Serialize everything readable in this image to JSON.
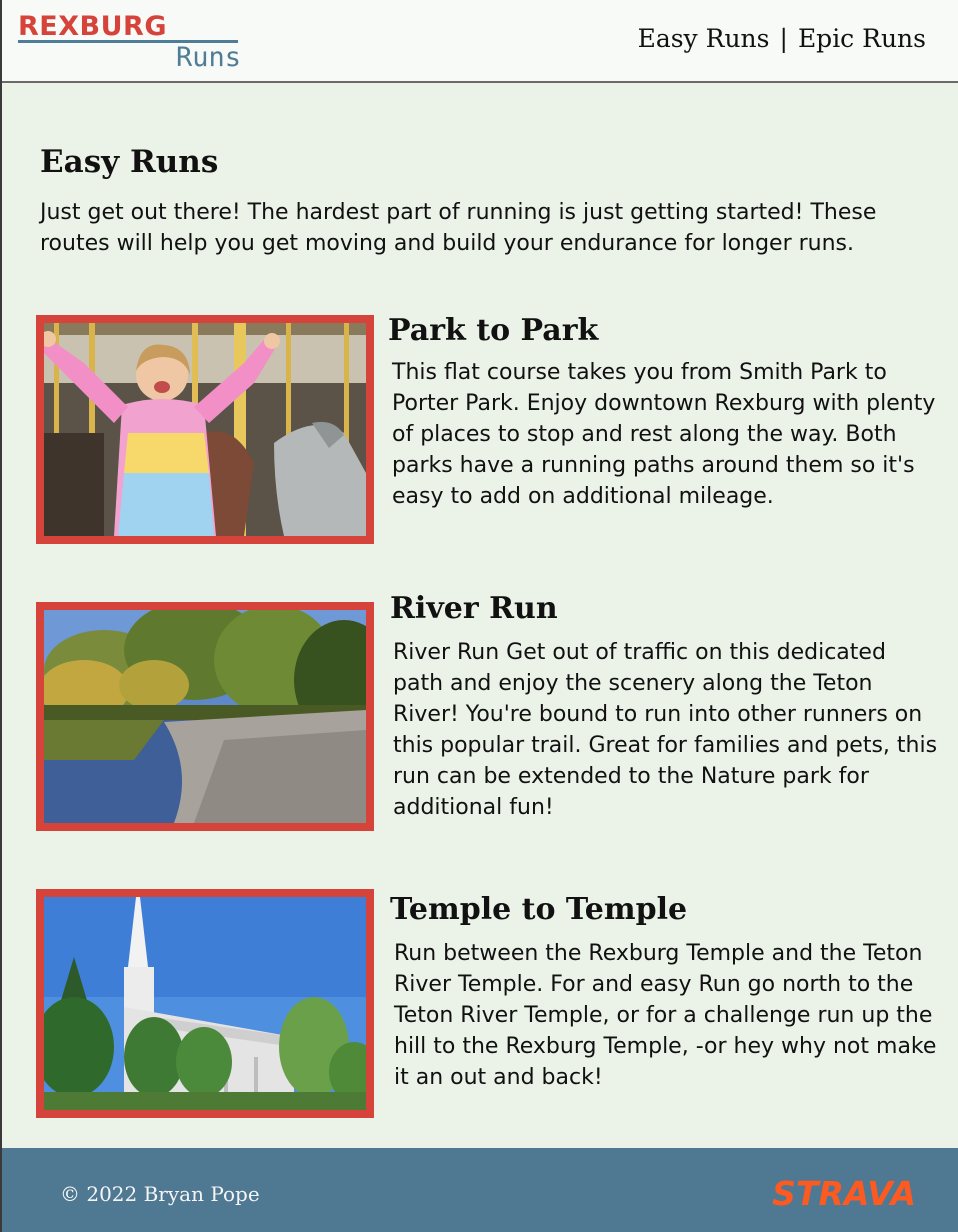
{
  "brand": {
    "top": "REXBURG",
    "bottom": "Runs"
  },
  "nav": {
    "easy": "Easy Runs",
    "separator": "|",
    "epic": "Epic Runs"
  },
  "page": {
    "title": "Easy Runs",
    "intro": "Just get out there! The hardest part of running is just getting started! These routes will help you get moving and build your endurance for longer runs."
  },
  "routes": [
    {
      "title": "Park to Park",
      "description": "This flat course takes you from Smith Park to Porter Park. Enjoy downtown Rexburg with plenty of places to stop and rest along the way. Both parks have a running paths around them so it's easy to add on additional mileage.",
      "photo": "carousel-girl-photo"
    },
    {
      "title": "River Run",
      "description": "River Run Get out of traffic on this dedicated path and enjoy the scenery along the Teton River! You're bound to run into other runners on this popular trail. Great for families and pets, this run can be extended to the Nature park for additional fun!",
      "photo": "river-photo"
    },
    {
      "title": "Temple to Temple",
      "description": "Run between the Rexburg Temple and the Teton River Temple. For and easy Run go north to the Teton River Temple, or for a challenge run up the hill to the Rexburg Temple, -or hey why not make it an out and back!",
      "photo": "temple-photo"
    }
  ],
  "footer": {
    "copyright": "© 2022 Bryan Pope",
    "partner": "STRAVA"
  },
  "colors": {
    "accent": "#d5433a",
    "brand_blue": "#4f7c96",
    "background": "#ebf2e8",
    "footer": "#4f7893",
    "strava": "#fc5a20"
  }
}
